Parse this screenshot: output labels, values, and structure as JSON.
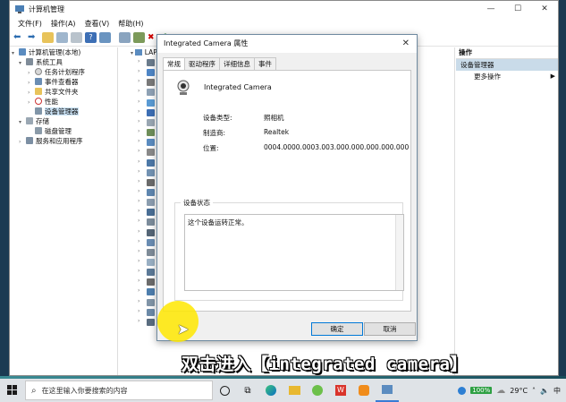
{
  "mmc": {
    "title": "计算机管理",
    "menu": [
      "文件(F)",
      "操作(A)",
      "查看(V)",
      "帮助(H)"
    ],
    "tree": [
      {
        "label": "计算机管理(本地)",
        "level": 0,
        "arrow": "▾",
        "icon": "computer-icon"
      },
      {
        "label": "系统工具",
        "level": 1,
        "arrow": "▾",
        "icon": "tools-icon"
      },
      {
        "label": "任务计划程序",
        "level": 2,
        "arrow": "›",
        "icon": "clock-icon"
      },
      {
        "label": "事件查看器",
        "level": 2,
        "arrow": "›",
        "icon": "event-icon"
      },
      {
        "label": "共享文件夹",
        "level": 2,
        "arrow": "›",
        "icon": "folder-icon"
      },
      {
        "label": "性能",
        "level": 2,
        "arrow": "›",
        "icon": "performance-icon"
      },
      {
        "label": "设备管理器",
        "level": 2,
        "arrow": "",
        "icon": "device-manager-icon",
        "selected": true
      },
      {
        "label": "存储",
        "level": 1,
        "arrow": "▾",
        "icon": "storage-icon"
      },
      {
        "label": "磁盘管理",
        "level": 2,
        "arrow": "",
        "icon": "disk-icon"
      },
      {
        "label": "服务和应用程序",
        "level": 1,
        "arrow": "›",
        "icon": "services-icon"
      }
    ],
    "device_root": "LAP",
    "actions": {
      "header": "操作",
      "selected": "设备管理器",
      "more": "更多操作"
    }
  },
  "dialog": {
    "title": "Integrated Camera 属性",
    "tabs": [
      "常规",
      "驱动程序",
      "详细信息",
      "事件"
    ],
    "active_tab": 0,
    "device_name": "Integrated Camera",
    "props": [
      {
        "label": "设备类型:",
        "value": "照相机"
      },
      {
        "label": "制造商:",
        "value": "Realtek"
      },
      {
        "label": "位置:",
        "value": "0004.0000.0003.003.000.000.000.000.000"
      }
    ],
    "status_group": "设备状态",
    "status_text": "这个设备运转正常。",
    "ok": "确定",
    "cancel": "取消"
  },
  "caption": "双击进入【integrated camera】",
  "taskbar": {
    "search_placeholder": "在这里输入你要搜索的内容",
    "battery": "100%",
    "temperature": "29°C",
    "ime": "中"
  },
  "colors": {
    "selection": "#cce4f7",
    "action_selected": "#c9dbe9",
    "highlight": "#ffe800"
  }
}
